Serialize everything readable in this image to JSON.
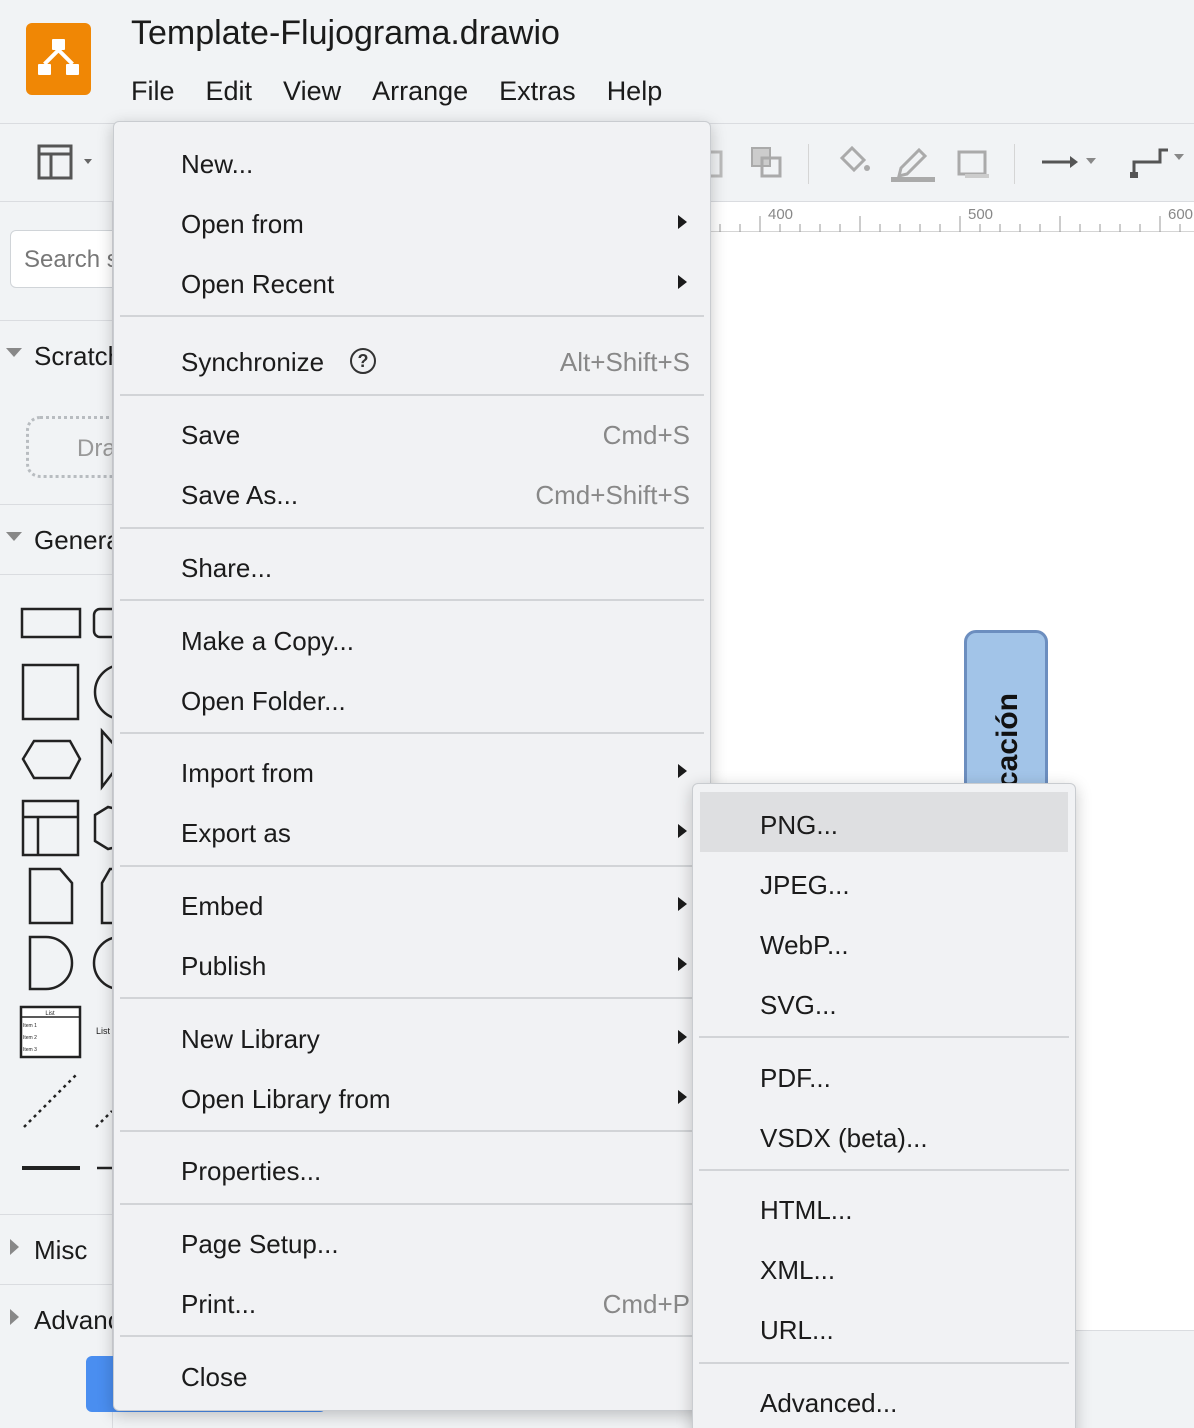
{
  "app": {
    "doc_title": "Template-Flujograma.drawio",
    "menus": [
      "File",
      "Edit",
      "View",
      "Arrange",
      "Extras",
      "Help"
    ]
  },
  "sidebar": {
    "search_placeholder": "Search shapes",
    "sections": [
      {
        "label": "Scratchpad",
        "expanded": true
      },
      {
        "label": "General",
        "expanded": true
      },
      {
        "label": "Misc",
        "expanded": false
      },
      {
        "label": "Advanced",
        "expanded": false
      }
    ],
    "drag_hint": "Drag elements here",
    "list_shape_title": "List",
    "list_shape_items": [
      "Item 1",
      "Item 2",
      "Item 3"
    ],
    "list_shape_label": "List"
  },
  "canvas": {
    "ruler_labels": [
      "400",
      "500",
      "600"
    ],
    "shape_text": "cación"
  },
  "file_menu": {
    "items": [
      {
        "label": "New...",
        "shortcut": "",
        "submenu": false
      },
      {
        "label": "Open from",
        "shortcut": "",
        "submenu": true
      },
      {
        "label": "Open Recent",
        "shortcut": "",
        "submenu": true
      },
      {
        "label": "Synchronize",
        "shortcut": "Alt+Shift+S",
        "submenu": false,
        "help": "?"
      },
      {
        "label": "Save",
        "shortcut": "Cmd+S",
        "submenu": false
      },
      {
        "label": "Save As...",
        "shortcut": "Cmd+Shift+S",
        "submenu": false
      },
      {
        "label": "Share...",
        "shortcut": "",
        "submenu": false
      },
      {
        "label": "Make a Copy...",
        "shortcut": "",
        "submenu": false
      },
      {
        "label": "Open Folder...",
        "shortcut": "",
        "submenu": false
      },
      {
        "label": "Import from",
        "shortcut": "",
        "submenu": true
      },
      {
        "label": "Export as",
        "shortcut": "",
        "submenu": true
      },
      {
        "label": "Embed",
        "shortcut": "",
        "submenu": true
      },
      {
        "label": "Publish",
        "shortcut": "",
        "submenu": true
      },
      {
        "label": "New Library",
        "shortcut": "",
        "submenu": true
      },
      {
        "label": "Open Library from",
        "shortcut": "",
        "submenu": true
      },
      {
        "label": "Properties...",
        "shortcut": "",
        "submenu": false
      },
      {
        "label": "Page Setup...",
        "shortcut": "",
        "submenu": false
      },
      {
        "label": "Print...",
        "shortcut": "Cmd+P",
        "submenu": false
      },
      {
        "label": "Close",
        "shortcut": "",
        "submenu": false
      }
    ]
  },
  "export_menu": {
    "highlighted": "PNG...",
    "items": [
      "PNG...",
      "JPEG...",
      "WebP...",
      "SVG...",
      "PDF...",
      "VSDX (beta)...",
      "HTML...",
      "XML...",
      "URL...",
      "Advanced..."
    ]
  },
  "colors": {
    "brand": "#f08705",
    "chrome": "#f1f3f5",
    "menu_bg": "#f1f2f4",
    "highlight": "#dedfe1",
    "shape_fill": "#a2c4e8",
    "shape_stroke": "#6c8ebf"
  }
}
